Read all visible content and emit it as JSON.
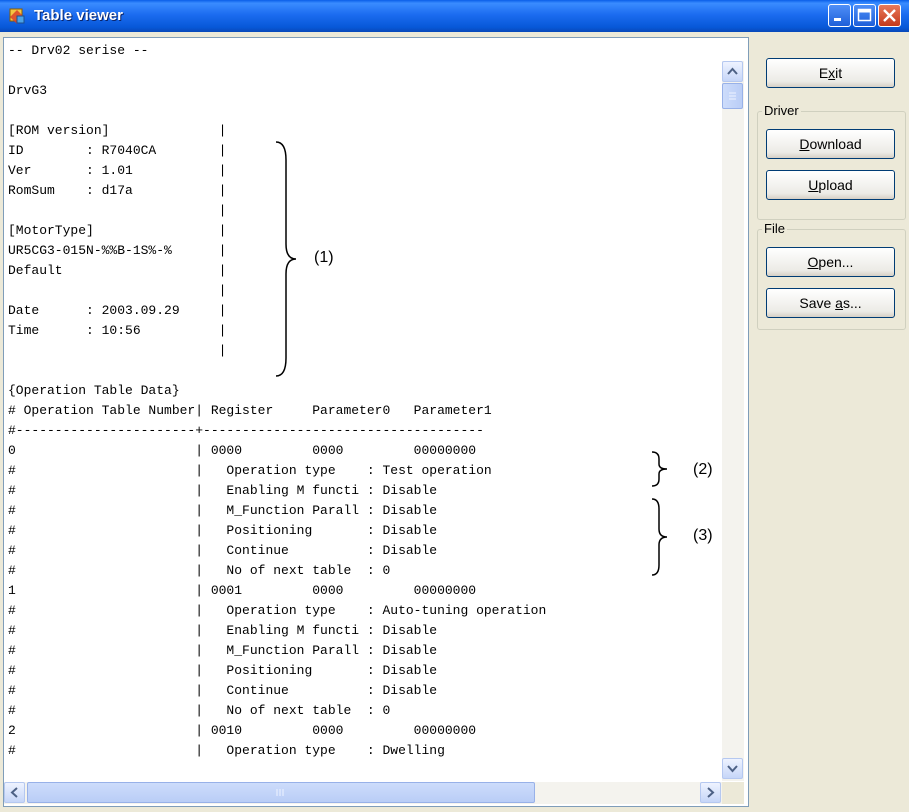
{
  "window": {
    "title": "Table viewer"
  },
  "buttons": {
    "exit": {
      "pre": "E",
      "key": "x",
      "post": "it"
    },
    "download": {
      "pre": "",
      "key": "D",
      "post": "ownload"
    },
    "upload": {
      "pre": "",
      "key": "U",
      "post": "pload"
    },
    "open": {
      "pre": "",
      "key": "O",
      "post": "pen..."
    },
    "save_as": {
      "pre": "Save ",
      "key": "a",
      "post": "s..."
    }
  },
  "groups": {
    "driver": "Driver",
    "file": "File"
  },
  "annotations": {
    "a1": "(1)",
    "a2": "(2)",
    "a3": "(3)"
  },
  "lines": [
    "-- Drv02 serise --",
    "",
    "DrvG3",
    "",
    "[ROM version]              |",
    "ID        : R7040CA        |",
    "Ver       : 1.01           |",
    "RomSum    : d17a           |",
    "                           |",
    "[MotorType]                |",
    "UR5CG3-015N-%%B-1S%-%      |",
    "Default                    |",
    "                           |",
    "Date      : 2003.09.29     |",
    "Time      : 10:56          |",
    "                           |",
    "",
    "{Operation Table Data}",
    "# Operation Table Number| Register     Parameter0   Parameter1",
    "#-----------------------+------------------------------------",
    "0                       | 0000         0000         00000000",
    "#                       |   Operation type    : Test operation",
    "#                       |   Enabling M functi : Disable",
    "#                       |   M_Function Parall : Disable",
    "#                       |   Positioning       : Disable",
    "#                       |   Continue          : Disable",
    "#                       |   No of next table  : 0",
    "1                       | 0001         0000         00000000",
    "#                       |   Operation type    : Auto-tuning operation",
    "#                       |   Enabling M functi : Disable",
    "#                       |   M_Function Parall : Disable",
    "#                       |   Positioning       : Disable",
    "#                       |   Continue          : Disable",
    "#                       |   No of next table  : 0",
    "2                       | 0010         0000         00000000",
    "#                       |   Operation type    : Dwelling"
  ],
  "icons": {
    "app": "table-viewer-app-icon",
    "minimize": "minimize-icon",
    "maximize": "maximize-icon",
    "close": "close-icon"
  },
  "colors": {
    "titlebar": "#0a5ee8",
    "window_bg": "#ece9d8",
    "button_border": "#003c74"
  }
}
